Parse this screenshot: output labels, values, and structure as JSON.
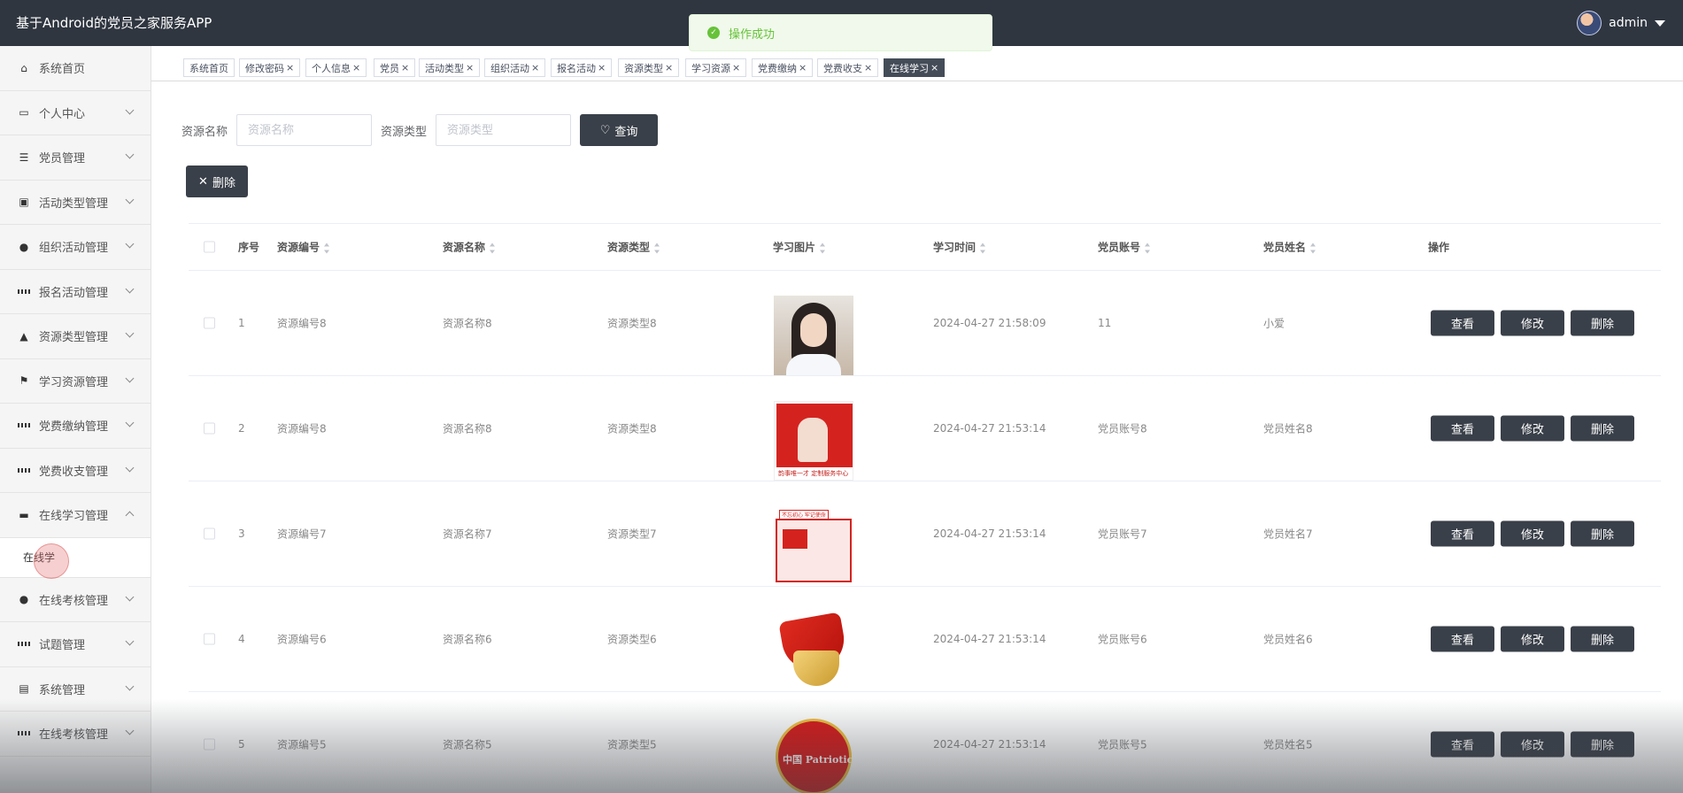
{
  "header": {
    "app_title": "基于Android的党员之家服务APP",
    "username": "admin",
    "icons": {
      "user": "avatar",
      "dropdown": "caret-down-icon"
    }
  },
  "toast": {
    "message": "操作成功",
    "icon": "success-check-icon",
    "color": "#67c23a"
  },
  "sidebar": {
    "items": [
      {
        "label": "系统首页",
        "icon": "home-icon",
        "expandable": false
      },
      {
        "label": "个人中心",
        "icon": "card-icon",
        "expandable": true
      },
      {
        "label": "党员管理",
        "icon": "list-icon",
        "expandable": true
      },
      {
        "label": "活动类型管理",
        "icon": "clipboard-icon",
        "expandable": true
      },
      {
        "label": "组织活动管理",
        "icon": "person-icon",
        "expandable": true
      },
      {
        "label": "报名活动管理",
        "icon": "grid-icon",
        "expandable": true
      },
      {
        "label": "资源类型管理",
        "icon": "thumbs-up-icon",
        "expandable": true
      },
      {
        "label": "学习资源管理",
        "icon": "flag-icon",
        "expandable": true
      },
      {
        "label": "党费缴纳管理",
        "icon": "grid-icon",
        "expandable": true
      },
      {
        "label": "党费收支管理",
        "icon": "grid-icon",
        "expandable": true
      },
      {
        "label": "在线学习管理",
        "icon": "box-icon",
        "expandable": true,
        "expanded": true
      },
      {
        "label": "在线考核管理",
        "icon": "person-icon",
        "expandable": true
      },
      {
        "label": "试题管理",
        "icon": "grid-icon",
        "expandable": true
      },
      {
        "label": "系统管理",
        "icon": "briefcase-icon",
        "expandable": true
      },
      {
        "label": "在线考核管理",
        "icon": "grid-icon",
        "expandable": true
      }
    ],
    "submenu": {
      "label": "在线学"
    }
  },
  "tags": [
    {
      "label": "系统首页",
      "closable": false
    },
    {
      "label": "修改密码",
      "closable": true
    },
    {
      "label": "个人信息",
      "closable": true
    },
    {
      "label": "党员",
      "closable": true
    },
    {
      "label": "活动类型",
      "closable": true
    },
    {
      "label": "组织活动",
      "closable": true
    },
    {
      "label": "报名活动",
      "closable": true
    },
    {
      "label": "资源类型",
      "closable": true
    },
    {
      "label": "学习资源",
      "closable": true
    },
    {
      "label": "党费缴纳",
      "closable": true
    },
    {
      "label": "党费收支",
      "closable": true
    },
    {
      "label": "在线学习",
      "closable": true,
      "active": true
    }
  ],
  "close_glyph": "×",
  "search": {
    "name_label": "资源名称",
    "name_placeholder": "资源名称",
    "type_label": "资源类型",
    "type_placeholder": "资源类型",
    "query_button": "查询",
    "query_icon": "heart-icon"
  },
  "toolbar": {
    "delete_button": "删除",
    "delete_icon": "close-icon"
  },
  "table": {
    "columns": [
      "序号",
      "资源编号",
      "资源名称",
      "资源类型",
      "学习图片",
      "学习时间",
      "党员账号",
      "党员姓名",
      "操作"
    ],
    "actions": {
      "view": "查看",
      "edit": "修改",
      "delete": "删除"
    },
    "rows": [
      {
        "index": "1",
        "code": "资源编号8",
        "name": "资源名称8",
        "type": "资源类型8",
        "image": "portrait-photo",
        "time": "2024-04-27 21:58:09",
        "account": "11",
        "member_name": "小爱"
      },
      {
        "index": "2",
        "code": "资源编号8",
        "name": "资源名称8",
        "type": "资源类型8",
        "image": "red-poster",
        "image_caption": "韵事唯一才 定制服务中心",
        "time": "2024-04-27 21:53:14",
        "account": "党员账号8",
        "member_name": "党员姓名8"
      },
      {
        "index": "3",
        "code": "资源编号7",
        "name": "资源名称7",
        "type": "资源类型7",
        "image": "party-poster",
        "image_caption": "不忘初心 牢记使命",
        "time": "2024-04-27 21:53:14",
        "account": "党员账号7",
        "member_name": "党员姓名7"
      },
      {
        "index": "4",
        "code": "资源编号6",
        "name": "资源名称6",
        "type": "资源类型6",
        "image": "party-badge",
        "time": "2024-04-27 21:53:14",
        "account": "党员账号6",
        "member_name": "党员姓名6"
      },
      {
        "index": "5",
        "code": "资源编号5",
        "name": "资源名称5",
        "type": "资源类型5",
        "image": "patriotic-heart",
        "image_caption": "中国 Patriotic",
        "time": "2024-04-27 21:53:14",
        "account": "党员账号5",
        "member_name": "党员姓名5"
      }
    ]
  },
  "colors": {
    "header_bg": "#2f3640",
    "button_dark": "#3a4049",
    "active_tag": "#444c58",
    "sidebar_bg": "#f5f5f5"
  }
}
